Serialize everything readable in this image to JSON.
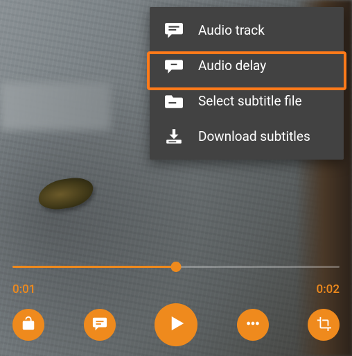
{
  "colors": {
    "accent": "#ef8a1d",
    "menu_bg": "#424242",
    "highlight": "#ff7a1a"
  },
  "menu": {
    "items": [
      {
        "label": "Audio track",
        "icon": "speech-lines-icon"
      },
      {
        "label": "Audio delay",
        "icon": "speech-arrows-icon"
      },
      {
        "label": "Select subtitle file",
        "icon": "folder-icon"
      },
      {
        "label": "Download subtitles",
        "icon": "download-icon"
      }
    ],
    "highlighted_index": 1
  },
  "player": {
    "progress_fraction": 0.5,
    "time_current": "0:01",
    "time_total": "0:02",
    "buttons": {
      "lock": "lock-open-icon",
      "subtitles": "subtitles-icon",
      "play": "play-icon",
      "more": "more-icon",
      "crop": "crop-icon"
    }
  }
}
